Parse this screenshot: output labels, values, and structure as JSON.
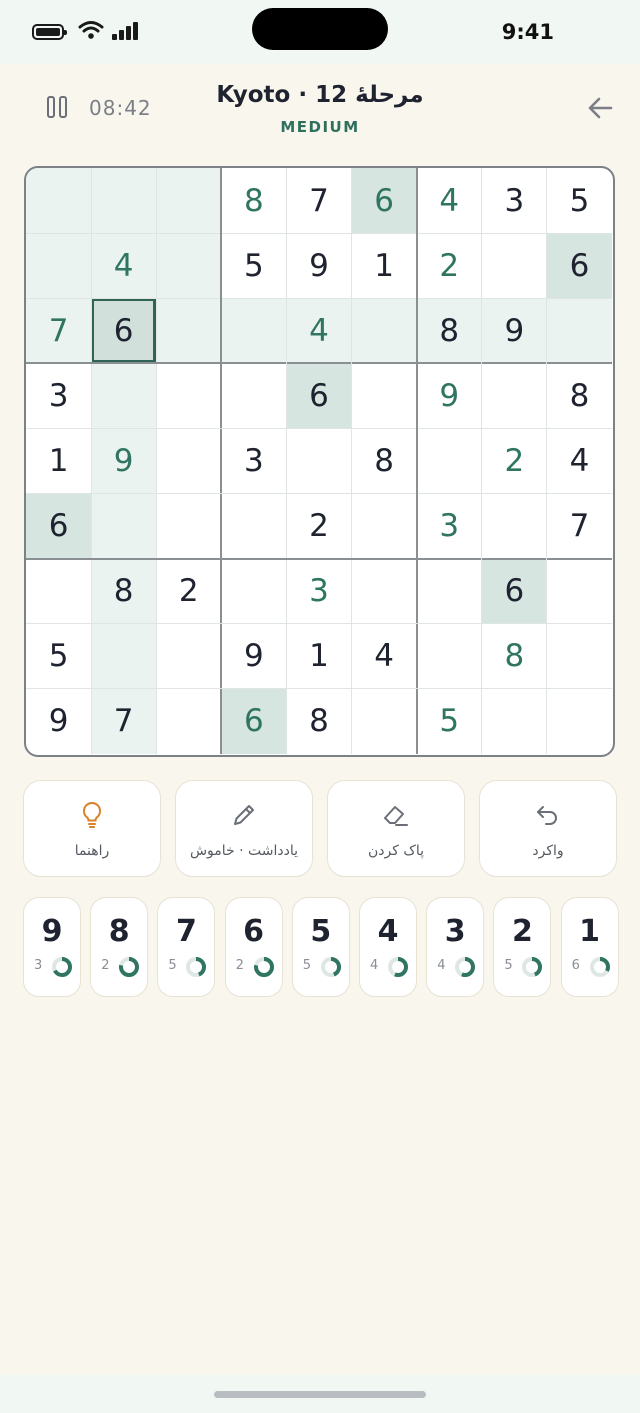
{
  "status": {
    "time": "9:41"
  },
  "header": {
    "timer": "08:42",
    "title": "Kyoto · مرحلهٔ 12",
    "difficulty": "MEDIUM"
  },
  "board": {
    "selected": [
      2,
      1
    ],
    "rows": [
      [
        "",
        "",
        "",
        "8",
        "7",
        "6",
        "4",
        "3",
        "5"
      ],
      [
        "",
        "4",
        "",
        "5",
        "9",
        "1",
        "2",
        "",
        "6"
      ],
      [
        "7",
        "6",
        "",
        "",
        "4",
        "",
        "8",
        "9",
        ""
      ],
      [
        "3",
        "",
        "",
        "",
        "6",
        "",
        "9",
        "",
        "8"
      ],
      [
        "1",
        "9",
        "",
        "3",
        "",
        "8",
        "",
        "2",
        "4"
      ],
      [
        "6",
        "",
        "",
        "",
        "2",
        "",
        "3",
        "",
        "7"
      ],
      [
        "",
        "8",
        "2",
        "",
        "3",
        "",
        "",
        "6",
        ""
      ],
      [
        "5",
        "",
        "",
        "9",
        "1",
        "4",
        "",
        "8",
        ""
      ],
      [
        "9",
        "7",
        "",
        "6",
        "8",
        "",
        "5",
        "",
        ""
      ]
    ],
    "entered": [
      [
        0,
        3
      ],
      [
        0,
        5
      ],
      [
        0,
        6
      ],
      [
        1,
        1
      ],
      [
        1,
        6
      ],
      [
        2,
        0
      ],
      [
        2,
        4
      ],
      [
        3,
        6
      ],
      [
        4,
        1
      ],
      [
        4,
        7
      ],
      [
        5,
        6
      ],
      [
        6,
        4
      ],
      [
        7,
        7
      ],
      [
        8,
        3
      ],
      [
        8,
        6
      ]
    ]
  },
  "actions": [
    {
      "id": "hint",
      "label": "راهنما",
      "icon": "lightbulb-icon",
      "color": "#d9822b"
    },
    {
      "id": "notes",
      "label": "یادداشت · خاموش",
      "icon": "pencil-icon",
      "color": "#6b6f78"
    },
    {
      "id": "erase",
      "label": "پاک کردن",
      "icon": "eraser-icon",
      "color": "#6b6f78"
    },
    {
      "id": "undo",
      "label": "واکرد",
      "icon": "undo-icon",
      "color": "#6b6f78"
    }
  ],
  "numpad": [
    {
      "digit": "9",
      "remaining": "3",
      "progress": 0.67
    },
    {
      "digit": "8",
      "remaining": "2",
      "progress": 0.78
    },
    {
      "digit": "7",
      "remaining": "5",
      "progress": 0.44
    },
    {
      "digit": "6",
      "remaining": "2",
      "progress": 0.78
    },
    {
      "digit": "5",
      "remaining": "5",
      "progress": 0.44
    },
    {
      "digit": "4",
      "remaining": "4",
      "progress": 0.56
    },
    {
      "digit": "3",
      "remaining": "4",
      "progress": 0.56
    },
    {
      "digit": "2",
      "remaining": "5",
      "progress": 0.44
    },
    {
      "digit": "1",
      "remaining": "6",
      "progress": 0.33
    }
  ],
  "colors": {
    "accent": "#2f7562",
    "ring_track": "#dfe7e4"
  }
}
